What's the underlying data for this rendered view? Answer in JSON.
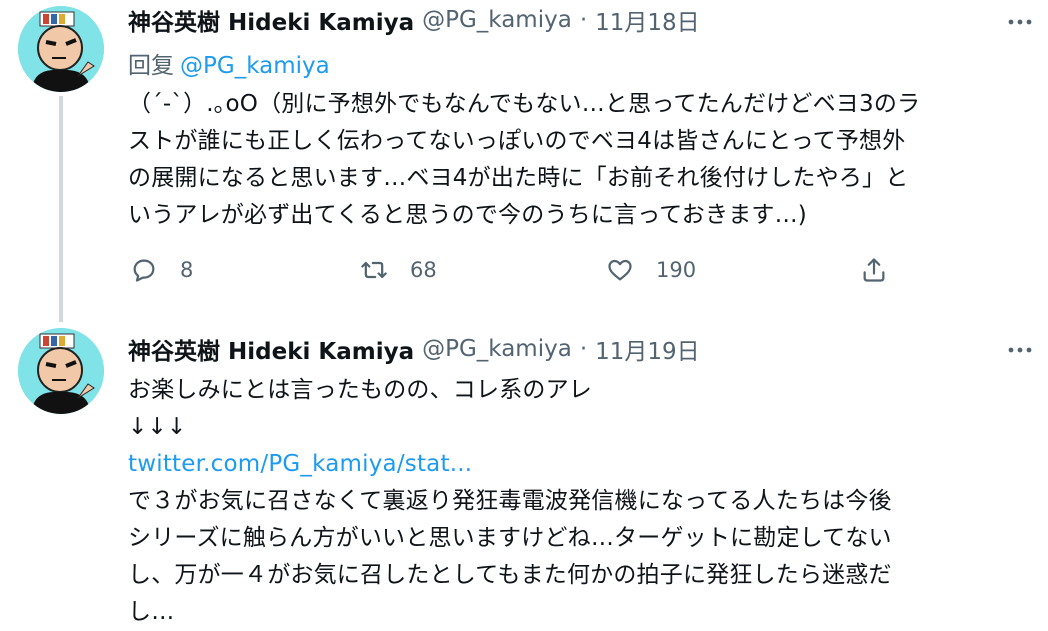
{
  "tweets": [
    {
      "name": "神谷英樹 Hideki Kamiya",
      "handle": "@PG_kamiya",
      "separator": "·",
      "date": "11月18日",
      "reply_label": "回复",
      "reply_mention": "@PG_kamiya",
      "lines": [
        "（´-`）.｡oO（別に予想外でもなんでもない…と思ってたんだけどベヨ3のラ",
        "ストが誰にも正しく伝わってないっぽいのでベヨ4は皆さんにとって予想外",
        "の展開になると思います…ベヨ4が出た時に「お前それ後付けしたやろ」と",
        "いうアレが必ず出てくると思うので今のうちに言っておきます…)"
      ],
      "actions": {
        "replies": "8",
        "retweets": "68",
        "likes": "190"
      }
    },
    {
      "name": "神谷英樹 Hideki Kamiya",
      "handle": "@PG_kamiya",
      "separator": "·",
      "date": "11月19日",
      "line1": "お楽しみにとは言ったものの、コレ系のアレ",
      "arrows": "↓↓↓",
      "link": "twitter.com/PG_kamiya/stat...",
      "lines": [
        "で３がお気に召さなくて裏返り発狂毒電波発信機になってる人たちは今後",
        "シリーズに触らん方がいいと思いますけどね…ターゲットに勘定してない",
        "し、万が一４がお気に召したとしてもまた何かの拍子に発狂したら迷惑だ",
        "し…"
      ]
    }
  ],
  "icons": {
    "more": "more-horizontal-icon",
    "reply": "reply-bubble-icon",
    "retweet": "retweet-icon",
    "like": "heart-icon",
    "share": "share-icon"
  },
  "colors": {
    "text": "#0f1419",
    "secondary": "#536471",
    "link": "#1d9bf0",
    "thread_line": "#cfd9de",
    "avatar_bg": "#7fe3e8"
  }
}
